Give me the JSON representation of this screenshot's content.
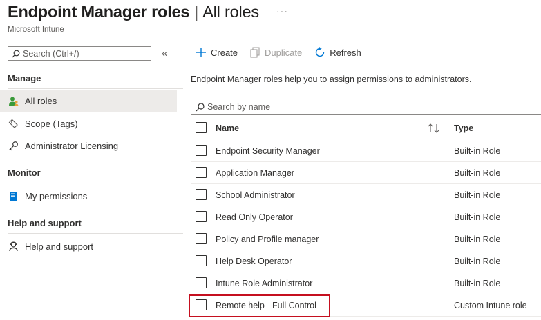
{
  "page": {
    "title": "Endpoint Manager roles",
    "separator": "|",
    "title_section": "All roles",
    "subtitle": "Microsoft Intune",
    "more_label": "···"
  },
  "sidebar": {
    "search_placeholder": "Search (Ctrl+/)",
    "collapse_label": "«",
    "sections": [
      {
        "label": "Manage"
      },
      {
        "label": "Monitor"
      },
      {
        "label": "Help and support"
      }
    ],
    "items": [
      {
        "label": "All roles",
        "icon": "users-icon",
        "active": true
      },
      {
        "label": "Scope (Tags)",
        "icon": "tag-icon"
      },
      {
        "label": "Administrator Licensing",
        "icon": "key-icon"
      },
      {
        "label": "My permissions",
        "icon": "book-icon"
      },
      {
        "label": "Help and support",
        "icon": "support-person-icon"
      }
    ]
  },
  "toolbar": {
    "create_label": "Create",
    "duplicate_label": "Duplicate",
    "refresh_label": "Refresh"
  },
  "main": {
    "description": "Endpoint Manager roles help you to assign permissions to administrators.",
    "search_placeholder": "Search by name",
    "table": {
      "columns": [
        "Name",
        "Type"
      ],
      "rows": [
        {
          "name": "Endpoint Security Manager",
          "type": "Built-in Role"
        },
        {
          "name": "Application Manager",
          "type": "Built-in Role"
        },
        {
          "name": "School Administrator",
          "type": "Built-in Role"
        },
        {
          "name": "Read Only Operator",
          "type": "Built-in Role"
        },
        {
          "name": "Policy and Profile manager",
          "type": "Built-in Role"
        },
        {
          "name": "Help Desk Operator",
          "type": "Built-in Role"
        },
        {
          "name": "Intune Role Administrator",
          "type": "Built-in Role"
        },
        {
          "name": "Remote help - Full Control",
          "type": "Custom Intune role",
          "highlighted": true
        }
      ]
    }
  },
  "colors": {
    "accent": "#0078d4",
    "highlight_border": "#c50f1f",
    "active_nav_bg": "#edebe9"
  }
}
